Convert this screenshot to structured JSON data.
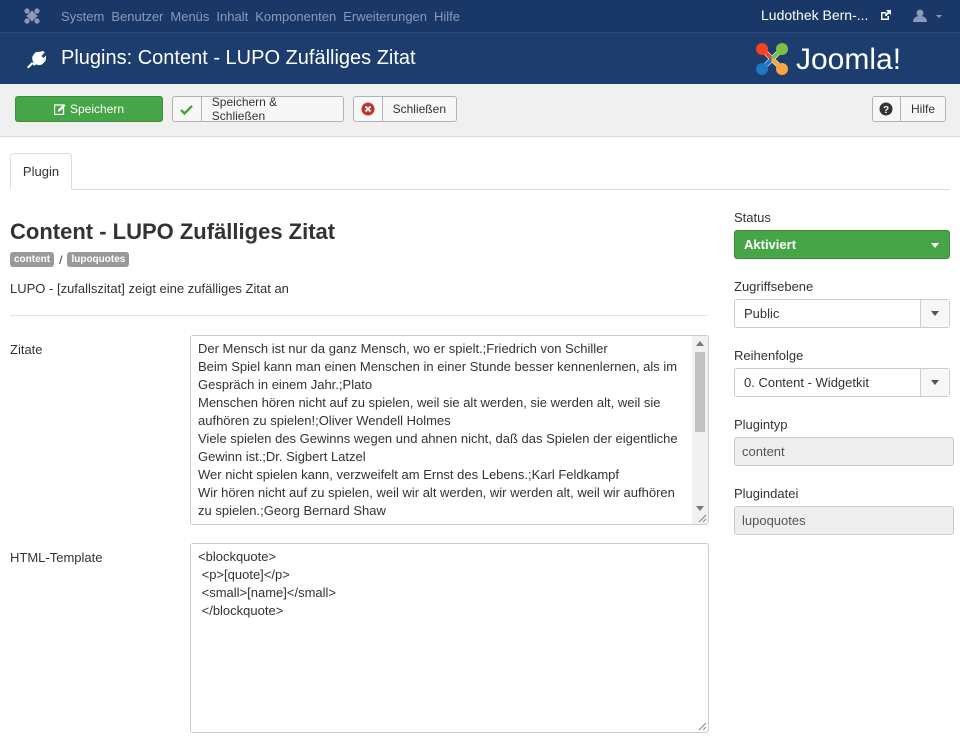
{
  "topnav": {
    "menu": [
      "System",
      "Benutzer",
      "Menüs",
      "Inhalt",
      "Komponenten",
      "Erweiterungen",
      "Hilfe"
    ],
    "site_name": "Ludothek Bern-..."
  },
  "header": {
    "title": "Plugins: Content - LUPO Zufälliges Zitat",
    "brand": "Joomla!"
  },
  "toolbar": {
    "save": "Speichern",
    "save_close": "Speichern & Schließen",
    "close": "Schließen",
    "help": "Hilfe"
  },
  "tabs": [
    "Plugin"
  ],
  "plugin": {
    "title": "Content - LUPO Zufälliges Zitat",
    "folder": "content",
    "element": "lupoquotes",
    "description": "LUPO - [zufallszitat] zeigt eine zufälliges Zitat an"
  },
  "fields": {
    "quotes_label": "Zitate",
    "quotes_lines": [
      "Der Mensch ist nur da ganz Mensch, wo er spielt.;Friedrich von Schiller",
      "Beim Spiel kann man einen Menschen in einer Stunde besser kennenlernen, als im",
      "Gespräch in einem Jahr.;Plato",
      "Menschen hören nicht auf zu spielen, weil sie alt werden, sie werden alt, weil sie",
      "aufhören zu spielen!;Oliver Wendell Holmes",
      "Viele spielen des Gewinns wegen und ahnen nicht, daß das Spielen der eigentliche",
      "Gewinn ist.;Dr. Sigbert Latzel",
      "Wer nicht spielen kann, verzweifelt am Ernst des Lebens.;Karl Feldkampf",
      "Wir hören nicht auf zu spielen, weil wir alt werden, wir werden alt, weil wir aufhören",
      "zu spielen.;Georg Bernard Shaw"
    ],
    "template_label": "HTML-Template",
    "template_lines": [
      "<blockquote>",
      " <p>[quote]</p>",
      " <small>[name]</small>",
      " </blockquote>"
    ]
  },
  "sidebar": {
    "status_label": "Status",
    "status_value": "Aktiviert",
    "access_label": "Zugriffsebene",
    "access_value": "Public",
    "ordering_label": "Reihenfolge",
    "ordering_value": "0. Content - Widgetkit",
    "type_label": "Plugintyp",
    "type_value": "content",
    "file_label": "Plugindatei",
    "file_value": "lupoquotes"
  },
  "colors": {
    "navbar": "#1a3867",
    "header": "#1c3d6e",
    "success": "#46a546"
  }
}
